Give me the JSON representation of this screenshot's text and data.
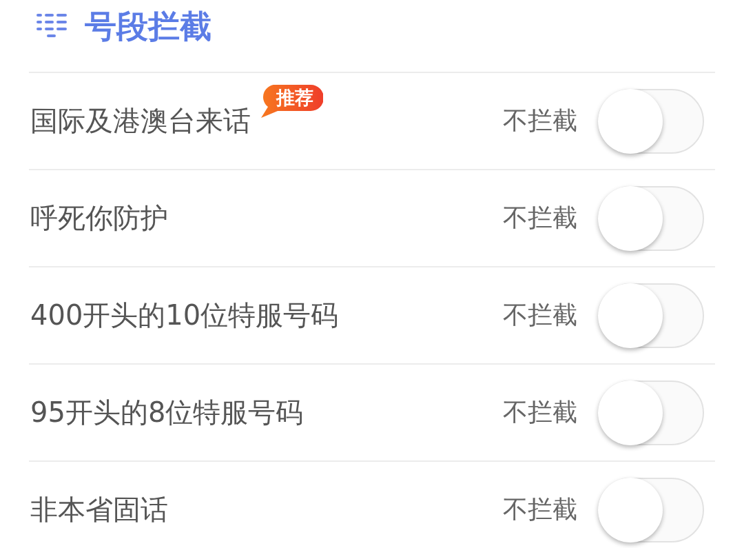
{
  "header": {
    "title": "号段拦截"
  },
  "rows": [
    {
      "label": "国际及港澳台来话",
      "badge": "推荐",
      "status": "不拦截",
      "on": false
    },
    {
      "label": "呼死你防护",
      "status": "不拦截",
      "on": false
    },
    {
      "label": "400开头的10位特服号码",
      "status": "不拦截",
      "on": false
    },
    {
      "label": "95开头的8位特服号码",
      "status": "不拦截",
      "on": false
    },
    {
      "label": "非本省固话",
      "status": "不拦截",
      "on": false
    }
  ]
}
